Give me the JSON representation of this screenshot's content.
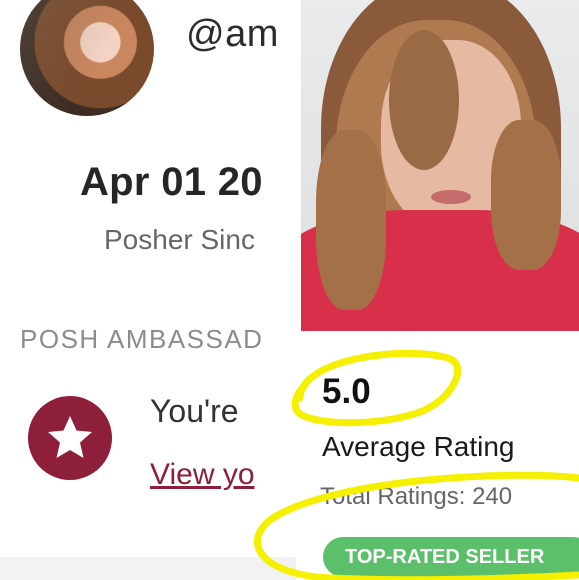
{
  "profile": {
    "username": "@am",
    "date": "Apr 01 20",
    "posher_since": "Posher Sinc",
    "ambassador_label": "POSH AMBASSAD",
    "ambassador_text": "You're",
    "view_link": "View yo"
  },
  "rating": {
    "value": "5.0",
    "label": "Average Rating",
    "total_ratings": "Total Ratings: 240",
    "top_rated_badge": "TOP-RATED SELLER"
  },
  "icons": {
    "badge": "star-icon"
  },
  "colors": {
    "brand_maroon": "#8d1f3a",
    "badge_green": "#5cc06a",
    "highlighter_yellow": "#f4f000"
  }
}
